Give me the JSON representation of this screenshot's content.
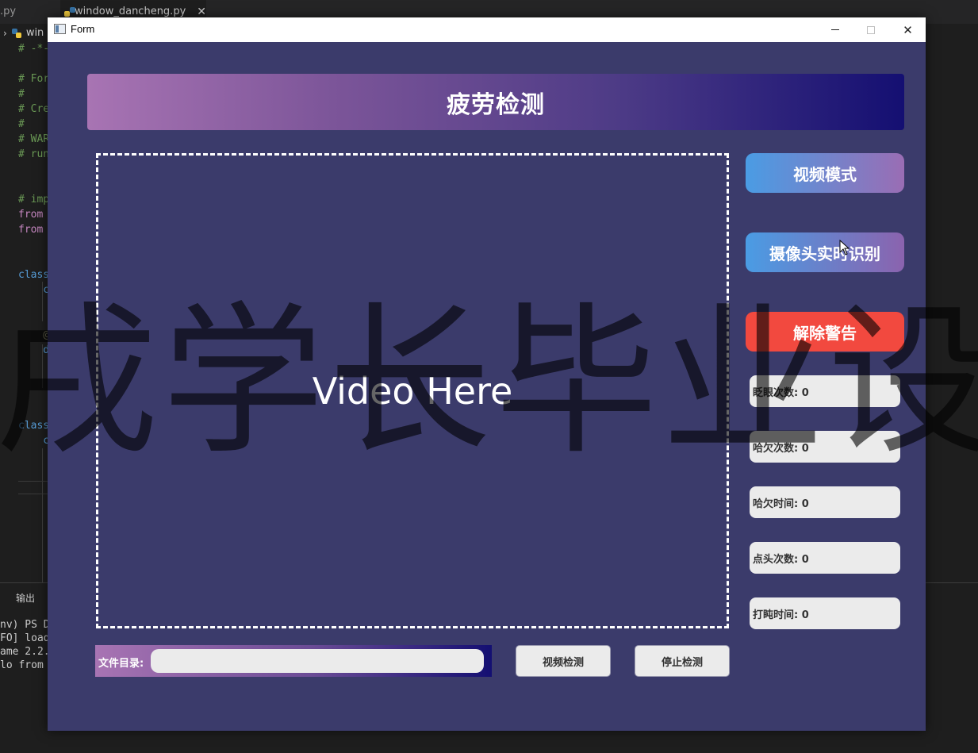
{
  "editor": {
    "prev_tab": ".py",
    "active_tab": "window_dancheng.py",
    "breadcrumb": "win",
    "code_lines": [
      "# -*-",
      "",
      "# For",
      "#",
      "# Cre",
      "#",
      "# WAR",
      "# run",
      "",
      "",
      "# imp",
      "from",
      "from",
      "",
      "",
      "class",
      "    c",
      "",
      "",
      "    @",
      "    d",
      "",
      "",
      "",
      "",
      "class",
      "    c"
    ],
    "panel_title": "输出",
    "terminal_lines": [
      "nv) PS D:",
      "FO] loadi",
      "ame 2.2.0",
      "lo from t"
    ]
  },
  "window": {
    "title": "Form",
    "header": "疲劳检测",
    "video_placeholder": "Video Here",
    "buttons": {
      "video_mode": "视频模式",
      "camera": "摄像头实时识别",
      "clear_alarm": "解除警告",
      "detect": "视频检测",
      "stop": "停止检测"
    },
    "stats": {
      "blink": "眨眼次数: 0",
      "yawn": "哈欠次数: 0",
      "yawn_time": "哈欠时间: 0",
      "nod": "点头次数: 0",
      "nap": "打盹时间: 0"
    },
    "file_label": "文件目录:",
    "file_value": ""
  },
  "watermark": "戌学长毕业设",
  "colors": {
    "window_bg": "#3b3b6b",
    "alarm": "#f2493f",
    "accent_blue": "#4a9ce4",
    "accent_purple": "#9a6db4"
  }
}
